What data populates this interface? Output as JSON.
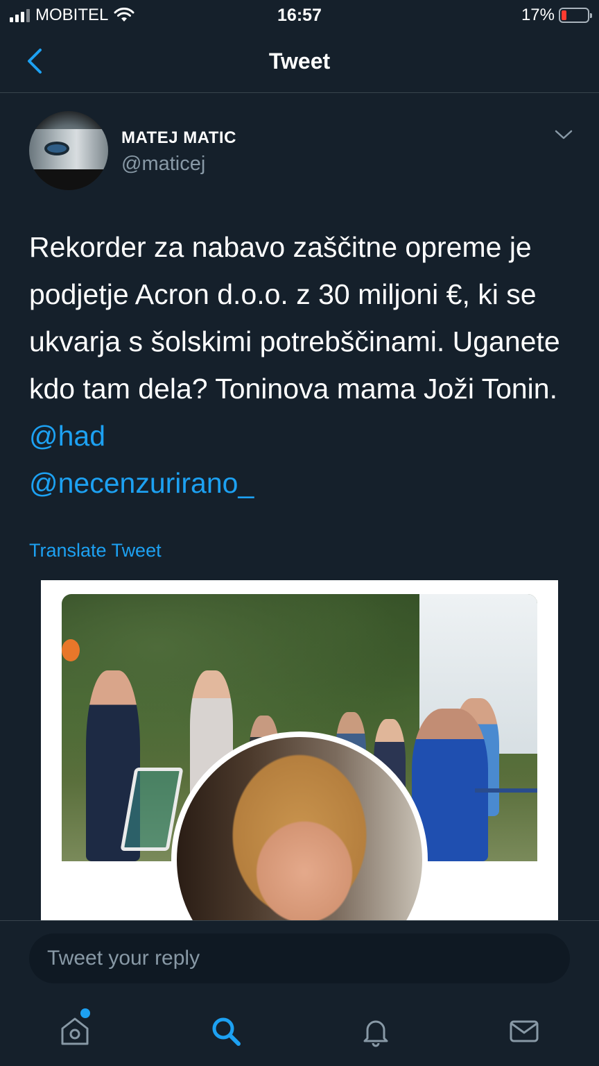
{
  "status_bar": {
    "carrier": "MOBITEL",
    "time": "16:57",
    "battery_percent": "17%",
    "battery_level": 0.17
  },
  "header": {
    "title": "Tweet"
  },
  "tweet": {
    "author_name": "MATEJ MATIC",
    "author_handle": "@maticej",
    "text_parts": [
      "Rekorder za nabavo zaščitne opreme je podjetje Acron d.o.o. z 30 miljoni €, ki se ukvarja s šolskimi potrebščinami. Uganete kdo tam dela? Toninova mama Joži Tonin. "
    ],
    "mentions": [
      "@had",
      "@necenzurirano_"
    ],
    "translate_label": "Translate Tweet"
  },
  "reply": {
    "placeholder": "Tweet your reply"
  },
  "tab_bar": {
    "items": [
      "home",
      "search",
      "notifications",
      "messages"
    ],
    "active": "search"
  },
  "colors": {
    "background": "#15202b",
    "accent": "#1da1f2",
    "secondary_text": "#8899a6",
    "divider": "#38444d"
  }
}
